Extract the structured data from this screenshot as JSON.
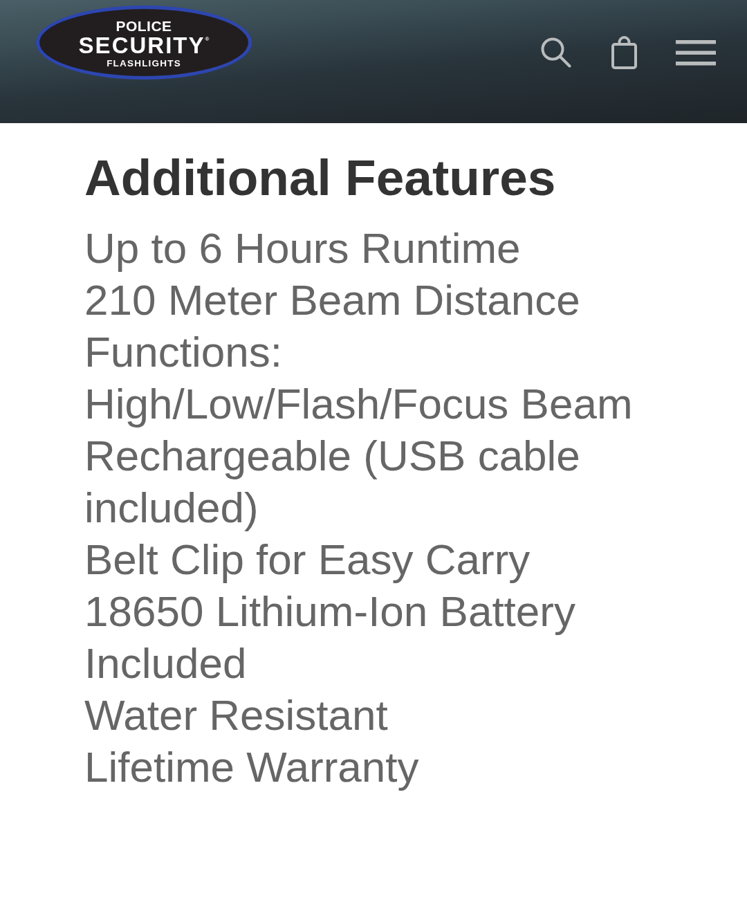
{
  "header": {
    "logo": {
      "line_1": "POLICE",
      "line_2": "SECURITY$^{®}$",
      "line_3": "FLASHLIGHTS"
    }
  },
  "section": {
    "heading": "Additional Features",
    "items": [
      "Up to 6 Hours Runtime",
      "210 Meter Beam Distance",
      "Functions: High/Low/Flash/Focus Beam",
      "Rechargeable (USB cable included)",
      "Belt Clip for Easy Carry",
      "18650 Lithium-Ion Battery Included",
      "Water Resistant",
      "Lifetime Warranty"
    ]
  }
}
